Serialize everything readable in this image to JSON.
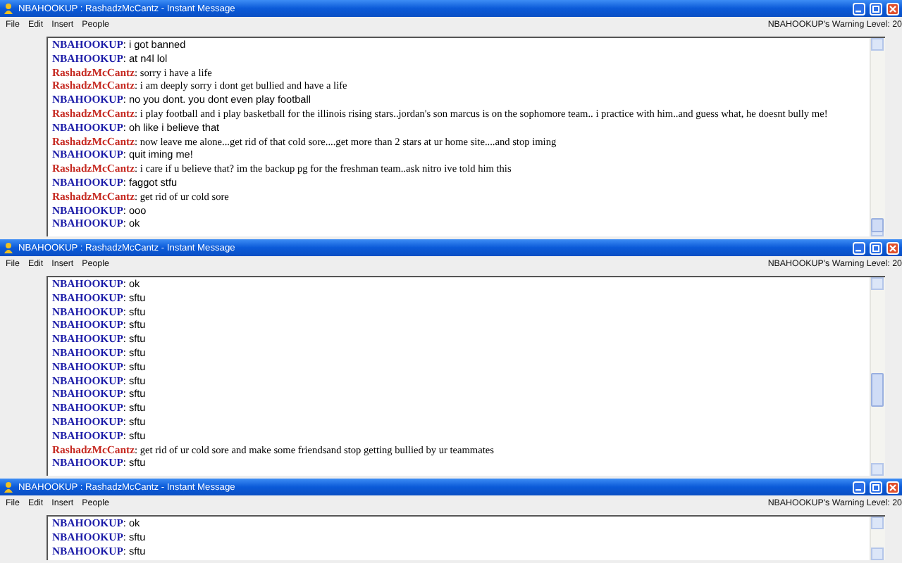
{
  "windows": [
    {
      "title": "NBAHOOKUP : RashadzMcCantz - Instant Message",
      "menu": [
        "File",
        "Edit",
        "Insert",
        "People"
      ],
      "warning": "NBAHOOKUP's Warning Level: 20",
      "messages": [
        {
          "kind": "self",
          "line": "**NBAHOOKUP**: i got banned"
        },
        {
          "kind": "self",
          "line": "**NBAHOOKUP**: at n4l lol"
        },
        {
          "kind": "buddy",
          "line": "**RashadzMcCantz**: sorry i have a life"
        },
        {
          "kind": "buddy",
          "line": "**RashadzMcCantz**: i am deeply sorry i dont get bullied and have a life"
        },
        {
          "kind": "self",
          "line": "**NBAHOOKUP**: no you dont. you dont even play football"
        },
        {
          "kind": "buddy",
          "line": "**RashadzMcCantz**: i play football and i play basketball for the illinois rising stars..jordan's son marcus is on the sophomore team.. i practice with him..and guess what, he doesnt bully me!"
        },
        {
          "kind": "self",
          "line": "**NBAHOOKUP**: oh like i believe that"
        },
        {
          "kind": "buddy",
          "line": "**RashadzMcCantz**: now leave me alone...get rid of that cold sore....get more than 2 stars at ur home site....and stop iming"
        },
        {
          "kind": "self",
          "line": "**NBAHOOKUP**: quit iming me!"
        },
        {
          "kind": "buddy",
          "line": "**RashadzMcCantz**: i care if u believe that?  im the backup pg for the freshman team..ask nitro ive told him this"
        },
        {
          "kind": "self",
          "line": "**NBAHOOKUP**: faggot stfu"
        },
        {
          "kind": "buddy",
          "line": "**RashadzMcCantz**: get rid of ur cold sore"
        },
        {
          "kind": "self",
          "line": "**NBAHOOKUP**: ooo"
        },
        {
          "kind": "self",
          "line": "**NBAHOOKUP**: ok"
        }
      ]
    },
    {
      "title": "NBAHOOKUP : RashadzMcCantz - Instant Message",
      "menu": [
        "File",
        "Edit",
        "Insert",
        "People"
      ],
      "warning": "NBAHOOKUP's Warning Level: 20",
      "messages": [
        {
          "kind": "self",
          "line": "**NBAHOOKUP**: ok"
        },
        {
          "kind": "self",
          "line": "**NBAHOOKUP**: sftu"
        },
        {
          "kind": "self",
          "line": "**NBAHOOKUP**: sftu"
        },
        {
          "kind": "self",
          "line": "**NBAHOOKUP**: sftu"
        },
        {
          "kind": "self",
          "line": "**NBAHOOKUP**: sftu"
        },
        {
          "kind": "self",
          "line": "**NBAHOOKUP**: sftu"
        },
        {
          "kind": "self",
          "line": "**NBAHOOKUP**: sftu"
        },
        {
          "kind": "self",
          "line": "**NBAHOOKUP**: sftu"
        },
        {
          "kind": "self",
          "line": "**NBAHOOKUP**: sftu"
        },
        {
          "kind": "self",
          "line": "**NBAHOOKUP**: sftu"
        },
        {
          "kind": "self",
          "line": "**NBAHOOKUP**: sftu"
        },
        {
          "kind": "self",
          "line": "**NBAHOOKUP**: sftu"
        },
        {
          "kind": "buddy",
          "line": "**RashadzMcCantz**: get rid of ur cold sore and make some friendsand stop getting bullied by ur teammates"
        },
        {
          "kind": "self",
          "line": "**NBAHOOKUP**: sftu"
        }
      ]
    },
    {
      "title": "NBAHOOKUP : RashadzMcCantz - Instant Message",
      "menu": [
        "File",
        "Edit",
        "Insert",
        "People"
      ],
      "warning": "NBAHOOKUP's Warning Level: 20",
      "messages": [
        {
          "kind": "self",
          "line": "**NBAHOOKUP**: ok"
        },
        {
          "kind": "self",
          "line": "**NBAHOOKUP**: sftu"
        },
        {
          "kind": "self",
          "line": "**NBAHOOKUP**: sftu"
        }
      ]
    }
  ]
}
